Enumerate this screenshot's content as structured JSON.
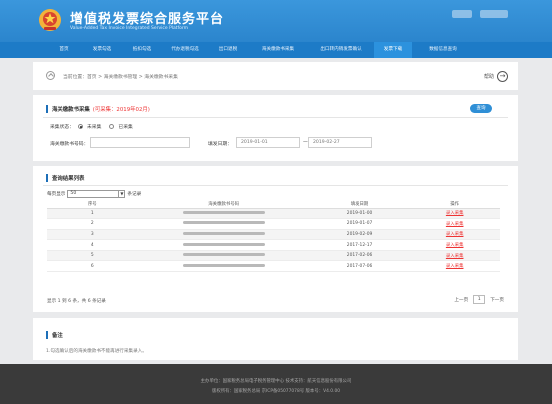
{
  "header": {
    "title": "增值税发票综合服务平台",
    "subtitle": "Value-Added Tax Invoice Integrated Service Platform",
    "brand_color": "#2f8fd6"
  },
  "nav": {
    "items": [
      "首页",
      "发票勾选",
      "抵扣勾选",
      "代办退税勾选",
      "出口退税",
      "海关缴款书采集",
      "出口转内销发票确认",
      "发票下载",
      "数据信息查询"
    ],
    "active_index": 7
  },
  "breadcrumb": {
    "path": "当前位置：首页 > 海关缴款书管理 > 海关缴款书采集",
    "help_label": "帮助"
  },
  "query": {
    "title": "海关缴款书采集",
    "note": "(可采集：2019年02月)",
    "button_label": "查询",
    "radio_label": "采集状态：",
    "radio_options": [
      "未采集",
      "已采集"
    ],
    "customs_label": "海关缴款书号码：",
    "customs_value": "",
    "date_label": "填发日期：",
    "date_from": "2019-01-01",
    "date_sep": "—",
    "date_to": "2019-02-27"
  },
  "list": {
    "title": "查询结果列表",
    "page_size_label": "每页显示",
    "page_size_value": "50",
    "page_size_suffix": "条记录",
    "columns": [
      "序号",
      "海关缴款书号码",
      "填发日期",
      "操作"
    ],
    "rows": [
      {
        "no": "1",
        "date": "2019-01-00",
        "action": "录入采集"
      },
      {
        "no": "2",
        "date": "2019-01-07",
        "action": "录入采集"
      },
      {
        "no": "3",
        "date": "2019-02-09",
        "action": "录入采集"
      },
      {
        "no": "4",
        "date": "2017-12-17",
        "action": "录入采集"
      },
      {
        "no": "5",
        "date": "2017-02-06",
        "action": "录入采集"
      },
      {
        "no": "6",
        "date": "2017-07-06",
        "action": "录入采集"
      }
    ],
    "pager_info": "显示 1 到 6 条，共 6 条记录",
    "pager_prev": "上一页",
    "pager_current": "1",
    "pager_next": "下一页"
  },
  "remark": {
    "title": "备注",
    "text": "1.勾选确认后的海关缴款书不能再进行采集录入。"
  },
  "footer": {
    "line1": "主办单位：国家税务总局电子税务管理中心    技术支持：航天信息股份有限公司",
    "line2": "版权所有：国家税务总局    京ICP备05077078号    版本号：V4.0.00"
  }
}
